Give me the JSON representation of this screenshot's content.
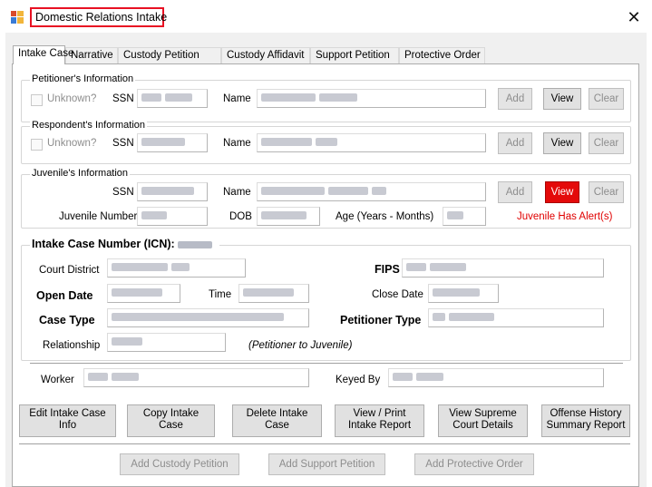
{
  "window": {
    "title": "Domestic Relations Intake",
    "close_glyph": "✕"
  },
  "tabs": [
    "Intake Case",
    "Narrative",
    "Custody Petition",
    "Custody Affidavit",
    "Support Petition",
    "Protective Order"
  ],
  "petitioner": {
    "legend": "Petitioner's Information",
    "unknown_label": "Unknown?",
    "ssn_label": "SSN",
    "name_label": "Name",
    "add": "Add",
    "view": "View",
    "clear": "Clear"
  },
  "respondent": {
    "legend": "Respondent's Information",
    "unknown_label": "Unknown?",
    "ssn_label": "SSN",
    "name_label": "Name",
    "add": "Add",
    "view": "View",
    "clear": "Clear"
  },
  "juvenile": {
    "legend": "Juvenile's Information",
    "ssn_label": "SSN",
    "name_label": "Name",
    "number_label": "Juvenile Number",
    "dob_label": "DOB",
    "age_label": "Age (Years - Months)",
    "alert_text": "Juvenile Has Alert(s)",
    "add": "Add",
    "view": "View",
    "clear": "Clear"
  },
  "intake": {
    "icn_label": "Intake Case Number (ICN):",
    "court_district_label": "Court District",
    "fips_label": "FIPS",
    "open_date_label": "Open Date",
    "time_label": "Time",
    "close_date_label": "Close Date",
    "case_type_label": "Case Type",
    "petitioner_type_label": "Petitioner Type",
    "relationship_label": "Relationship",
    "relationship_note": "(Petitioner to Juvenile)",
    "worker_label": "Worker",
    "keyed_by_label": "Keyed By"
  },
  "actions": {
    "edit": [
      "Edit Intake Case",
      "Info"
    ],
    "copy": [
      "Copy Intake",
      "Case"
    ],
    "delete": [
      "Delete Intake",
      "Case"
    ],
    "print": [
      "View / Print",
      "Intake Report"
    ],
    "supreme": [
      "View Supreme",
      "Court Details"
    ],
    "offense": [
      "Offense History",
      "Summary Report"
    ]
  },
  "bottom": {
    "add_custody": "Add Custody Petition",
    "add_support": "Add Support Petition",
    "add_protective": "Add Protective Order"
  },
  "colors": {
    "alert_red": "#e40a0a",
    "title_highlight": "#e81123"
  }
}
